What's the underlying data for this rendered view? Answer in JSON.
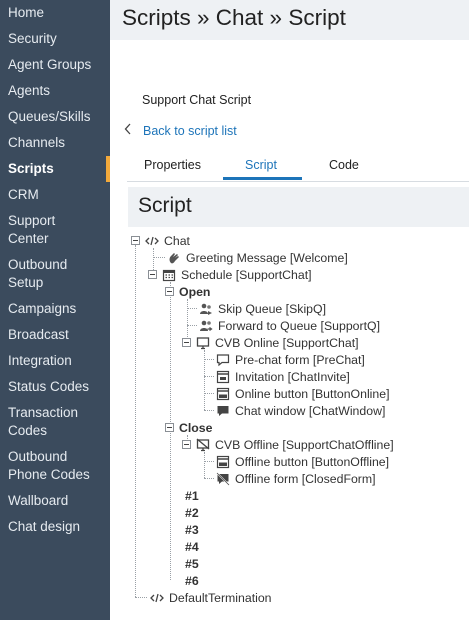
{
  "sidebar": {
    "items": [
      {
        "label": "Home"
      },
      {
        "label": "Security"
      },
      {
        "label": "Agent Groups"
      },
      {
        "label": "Agents"
      },
      {
        "label": "Queues/Skills"
      },
      {
        "label": "Channels"
      },
      {
        "label": "Scripts",
        "active": true
      },
      {
        "label": "CRM"
      },
      {
        "label": "Support Center"
      },
      {
        "label": "Outbound Setup"
      },
      {
        "label": "Campaigns"
      },
      {
        "label": "Broadcast"
      },
      {
        "label": "Integration"
      },
      {
        "label": "Status Codes"
      },
      {
        "label": "Transaction Codes"
      },
      {
        "label": "Outbound Phone Codes"
      },
      {
        "label": "Wallboard"
      },
      {
        "label": "Chat design"
      }
    ],
    "accent_color": "#f2a93b"
  },
  "header": {
    "title": "Scripts » Chat » Script"
  },
  "section_label": "Support Chat Script",
  "back_link": {
    "label": "Back to script list"
  },
  "tabs": [
    {
      "label": "Properties"
    },
    {
      "label": "Script",
      "active": true
    },
    {
      "label": "Code"
    }
  ],
  "panel": {
    "title": "Script"
  },
  "tree": {
    "chat": "Chat",
    "greeting": "Greeting Message [Welcome]",
    "schedule": "Schedule [SupportChat]",
    "open": "Open",
    "skip_queue": "Skip Queue [SkipQ]",
    "forward_queue": "Forward to Queue [SupportQ]",
    "cvb_online": "CVB Online [SupportChat]",
    "prechat": "Pre-chat form [PreChat]",
    "invitation": "Invitation [ChatInvite]",
    "online_button": "Online button [ButtonOnline]",
    "chat_window": "Chat window [ChatWindow]",
    "close": "Close",
    "cvb_offline": "CVB Offline [SupportChatOffline]",
    "offline_button": "Offline button [ButtonOffline]",
    "offline_form": "Offline form [ClosedForm]",
    "h1": "#1",
    "h2": "#2",
    "h3": "#3",
    "h4": "#4",
    "h5": "#5",
    "h6": "#6",
    "default_termination": "DefaultTermination"
  },
  "colors": {
    "sidebar_bg": "#3b4b5d",
    "link": "#1d74b9",
    "header_bg": "#eef1f4"
  }
}
